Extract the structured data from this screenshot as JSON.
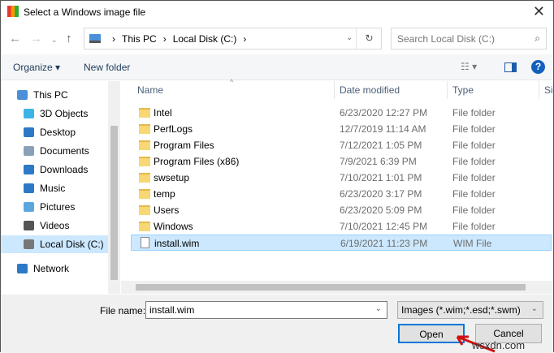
{
  "window": {
    "title": "Select a Windows image file"
  },
  "address": {
    "crumbs": [
      "This PC",
      "Local Disk (C:)"
    ],
    "search_placeholder": "Search Local Disk (C:)"
  },
  "toolbar": {
    "organize": "Organize ▾",
    "new_folder": "New folder"
  },
  "sidebar": [
    {
      "label": "This PC",
      "color": "#4a90d9",
      "indent": 0
    },
    {
      "label": "3D Objects",
      "color": "#3cb4e6",
      "indent": 1
    },
    {
      "label": "Desktop",
      "color": "#2b79c7",
      "indent": 1
    },
    {
      "label": "Documents",
      "color": "#8aa0b8",
      "indent": 1
    },
    {
      "label": "Downloads",
      "color": "#2b79c7",
      "indent": 1
    },
    {
      "label": "Music",
      "color": "#2b79c7",
      "indent": 1
    },
    {
      "label": "Pictures",
      "color": "#5aa7e0",
      "indent": 1
    },
    {
      "label": "Videos",
      "color": "#555",
      "indent": 1
    },
    {
      "label": "Local Disk (C:)",
      "color": "#777",
      "indent": 1,
      "selected": true
    },
    {
      "label": "Network",
      "color": "#2b79c7",
      "indent": 0
    }
  ],
  "columns": {
    "name": "Name",
    "date": "Date modified",
    "type": "Type",
    "size": "Si"
  },
  "files": [
    {
      "name": "Intel",
      "date": "6/23/2020 12:27 PM",
      "type": "File folder"
    },
    {
      "name": "PerfLogs",
      "date": "12/7/2019 11:14 AM",
      "type": "File folder"
    },
    {
      "name": "Program Files",
      "date": "7/12/2021 1:05 PM",
      "type": "File folder"
    },
    {
      "name": "Program Files (x86)",
      "date": "7/9/2021 6:39 PM",
      "type": "File folder"
    },
    {
      "name": "swsetup",
      "date": "7/10/2021 1:01 PM",
      "type": "File folder"
    },
    {
      "name": "temp",
      "date": "6/23/2020 3:17 PM",
      "type": "File folder"
    },
    {
      "name": "Users",
      "date": "6/23/2020 5:09 PM",
      "type": "File folder"
    },
    {
      "name": "Windows",
      "date": "7/10/2021 12:45 PM",
      "type": "File folder"
    },
    {
      "name": "install.wim",
      "date": "6/19/2021 11:23 PM",
      "type": "WIM File",
      "selected": true
    }
  ],
  "footer": {
    "file_name_label": "File name:",
    "file_name_value": "install.wim",
    "file_type": "Images (*.wim;*.esd;*.swm)",
    "open": "Open",
    "cancel": "Cancel"
  },
  "watermark": "wsxdn.com"
}
